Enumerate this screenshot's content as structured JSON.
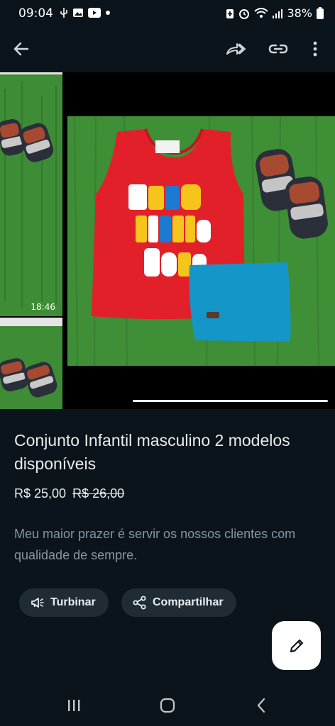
{
  "status_bar": {
    "time": "09:04",
    "battery": "38%",
    "icons": [
      "usb-icon",
      "image-icon",
      "youtube-icon",
      "dot-icon",
      "battery-saver-icon",
      "alarm-icon",
      "wifi-icon",
      "signal-icon",
      "battery-icon"
    ]
  },
  "app_bar": {
    "icons": [
      "back-arrow-icon",
      "forward-icon",
      "link-icon",
      "more-vert-icon"
    ]
  },
  "gallery": {
    "thumbnail_time": "18:46",
    "progress": 0.6
  },
  "product": {
    "title": "Conjunto Infantil masculino 2 modelos disponíveis",
    "price": "R$ 25,00",
    "old_price": "R$ 26,00",
    "description": "Meu maior prazer é servir os nossos clientes com qualidade de sempre."
  },
  "actions": {
    "boost_label": "Turbinar",
    "share_label": "Compartilhar"
  },
  "colors": {
    "background": "#0b141a",
    "chip": "#1f2c33",
    "muted_text": "#8696a0",
    "fab": "#ffffff"
  }
}
